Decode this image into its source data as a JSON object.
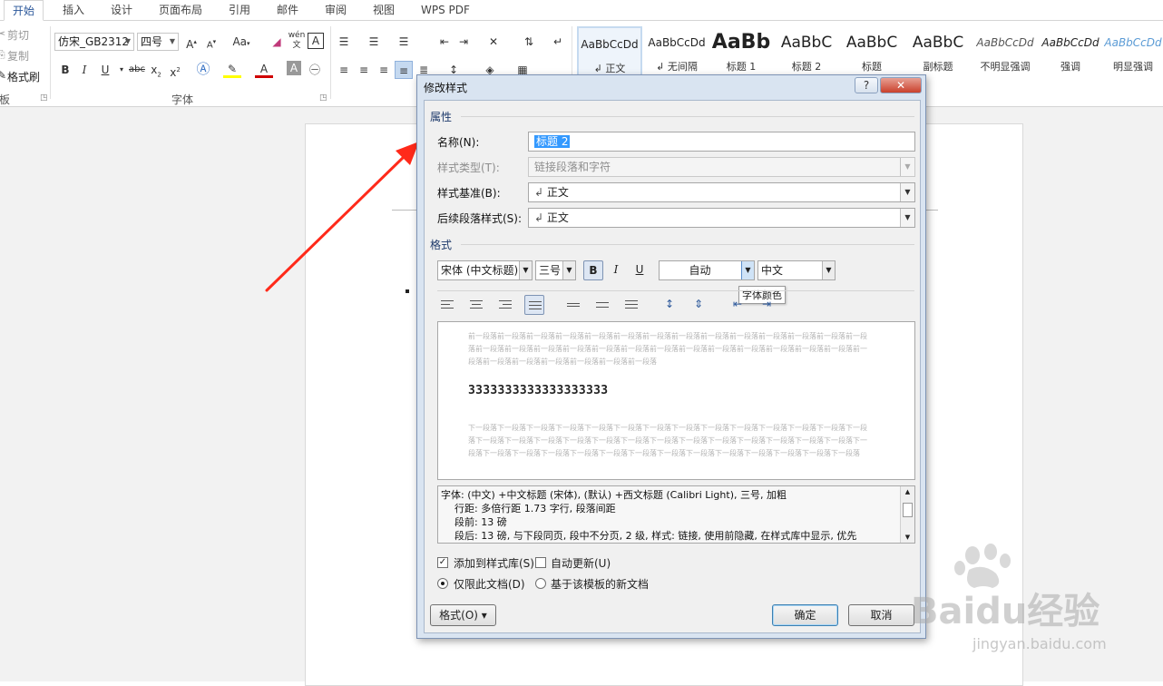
{
  "ribbon": {
    "tabs": [
      "开始",
      "插入",
      "设计",
      "页面布局",
      "引用",
      "邮件",
      "审阅",
      "视图",
      "WPS PDF"
    ],
    "clipboard": {
      "cut": "剪切",
      "copy": "复制",
      "format_painter": "格式刷",
      "group_label_partial": "板"
    },
    "font": {
      "font_name": "仿宋_GB2312",
      "font_size": "四号",
      "change_case": "Aa",
      "group_label": "字体",
      "pinyin_top": "wén",
      "pinyin_char": "文",
      "border_char": "A",
      "strike_text": "abc",
      "sub_label": "x",
      "sub_sub": "2",
      "sup_label": "x",
      "sup_sub": "2"
    },
    "styles": [
      {
        "sample": "AaBbCcDd",
        "label": "正文",
        "marker": "↲"
      },
      {
        "sample": "AaBbCcDd",
        "label": "无间隔",
        "marker": "↲"
      },
      {
        "sample": "AaBb",
        "label": "标题 1"
      },
      {
        "sample": "AaBbC",
        "label": "标题 2"
      },
      {
        "sample": "AaBbC",
        "label": "标题"
      },
      {
        "sample": "AaBbC",
        "label": "副标题"
      },
      {
        "sample": "AaBbCcDd",
        "label": "不明显强调"
      },
      {
        "sample": "AaBbCcDd",
        "label": "强调"
      },
      {
        "sample": "AaBbCcDd",
        "label": "明显强调"
      }
    ]
  },
  "dialog": {
    "title": "修改样式",
    "help_label": "?",
    "close_label": "✕",
    "properties_heading": "属性",
    "name_label": "名称(N):",
    "name_value": "标题 2",
    "style_type_label": "样式类型(T):",
    "style_type_value": "链接段落和字符",
    "based_on_label": "样式基准(B):",
    "based_on_value": "正文",
    "next_style_label": "后续段落样式(S):",
    "next_style_value": "正文",
    "para_marker": "↲",
    "format_heading": "格式",
    "font_family": "宋体 (中文标题)",
    "font_size": "三号",
    "bold_label": "B",
    "italic_label": "I",
    "underline_label": "U",
    "font_color": "自动",
    "script": "中文",
    "tooltip": "字体颜色",
    "preview": {
      "prev_paragraph": "前一段落前一段落前一段落前一段落前一段落前一段落前一段落前一段落前一段落前一段落前一段落前一段落前一段落前一段落前一段落前一段落前一段落前一段落前一段落前一段落前一段落前一段落前一段落前一段落前一段落前一段落前一段落前一段落前一段落前一段落前一段落前一段落前一段落前一段落",
      "sample_text": "3333333333333333333",
      "next_paragraph": "下一段落下一段落下一段落下一段落下一段落下一段落下一段落下一段落下一段落下一段落下一段落下一段落下一段落下一段落下一段落下一段落下一段落下一段落下一段落下一段落下一段落下一段落下一段落下一段落下一段落下一段落下一段落下一段落下一段落下一段落下一段落下一段落下一段落下一段落下一段落下一段落下一段落下一段落下一段落下一段落下一段落"
    },
    "description_lines": [
      "字体: (中文) +中文标题 (宋体), (默认) +西文标题 (Calibri Light), 三号, 加粗",
      "行距: 多倍行距 1.73 字行, 段落间距",
      "段前: 13 磅",
      "段后: 13 磅, 与下段同页, 段中不分页, 2 级, 样式: 链接, 使用前隐藏, 在样式库中显示, 优先"
    ],
    "add_to_gallery_label": "添加到样式库(S)",
    "add_to_gallery_checked": true,
    "auto_update_label": "自动更新(U)",
    "auto_update_checked": false,
    "only_this_doc_label": "仅限此文档(D)",
    "new_docs_label": "基于该模板的新文档",
    "format_button": "格式(O) ▾",
    "ok_button": "确定",
    "cancel_button": "取消"
  },
  "watermark": {
    "brand": "Baidu经验",
    "url": "jingyan.baidu.com"
  },
  "colors": {
    "accent": "#2b579a",
    "arrow": "#ff2a1a",
    "selection": "#3399ff"
  }
}
